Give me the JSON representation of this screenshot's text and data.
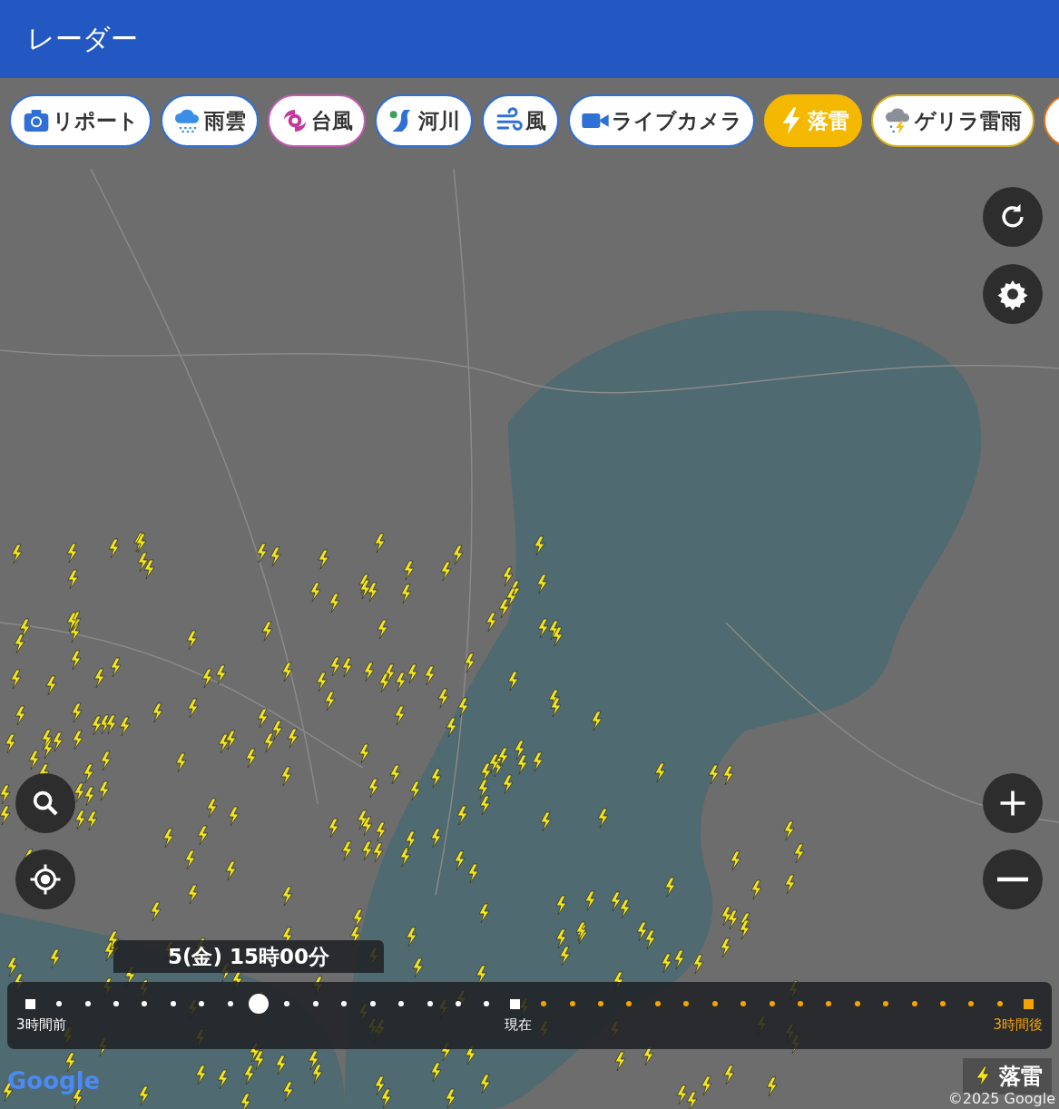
{
  "header": {
    "title": "レーダー"
  },
  "layers": [
    {
      "kind": "report",
      "label": "リポート",
      "color": "#2f6fd6",
      "selected": false
    },
    {
      "kind": "rain",
      "label": "雨雲",
      "color": "#2f6fd6",
      "selected": false
    },
    {
      "kind": "typhoon",
      "label": "台風",
      "color": "#c25bb0",
      "selected": false
    },
    {
      "kind": "river",
      "label": "河川",
      "color": "#2f6fd6",
      "selected": false
    },
    {
      "kind": "wind",
      "label": "風",
      "color": "#2f6fd6",
      "selected": false
    },
    {
      "kind": "camera",
      "label": "ライブカメラ",
      "color": "#2f6fd6",
      "selected": false
    },
    {
      "kind": "lightning",
      "label": "落雷",
      "color": "#f5b800",
      "selected": true
    },
    {
      "kind": "guerrilla",
      "label": "ゲリラ雷雨",
      "color": "#d9b21a",
      "selected": false
    },
    {
      "kind": "leaf",
      "color": "#e8731a",
      "selected": false
    }
  ],
  "time_label": "5(金) 15時00分",
  "timeline": {
    "start_label": "3時間前",
    "now_label": "現在",
    "end_label": "3時間後",
    "level": 0.23
  },
  "legend": {
    "label": "落雷"
  },
  "attribution": {
    "logo": "Google",
    "copyright": "©2025 Google"
  }
}
